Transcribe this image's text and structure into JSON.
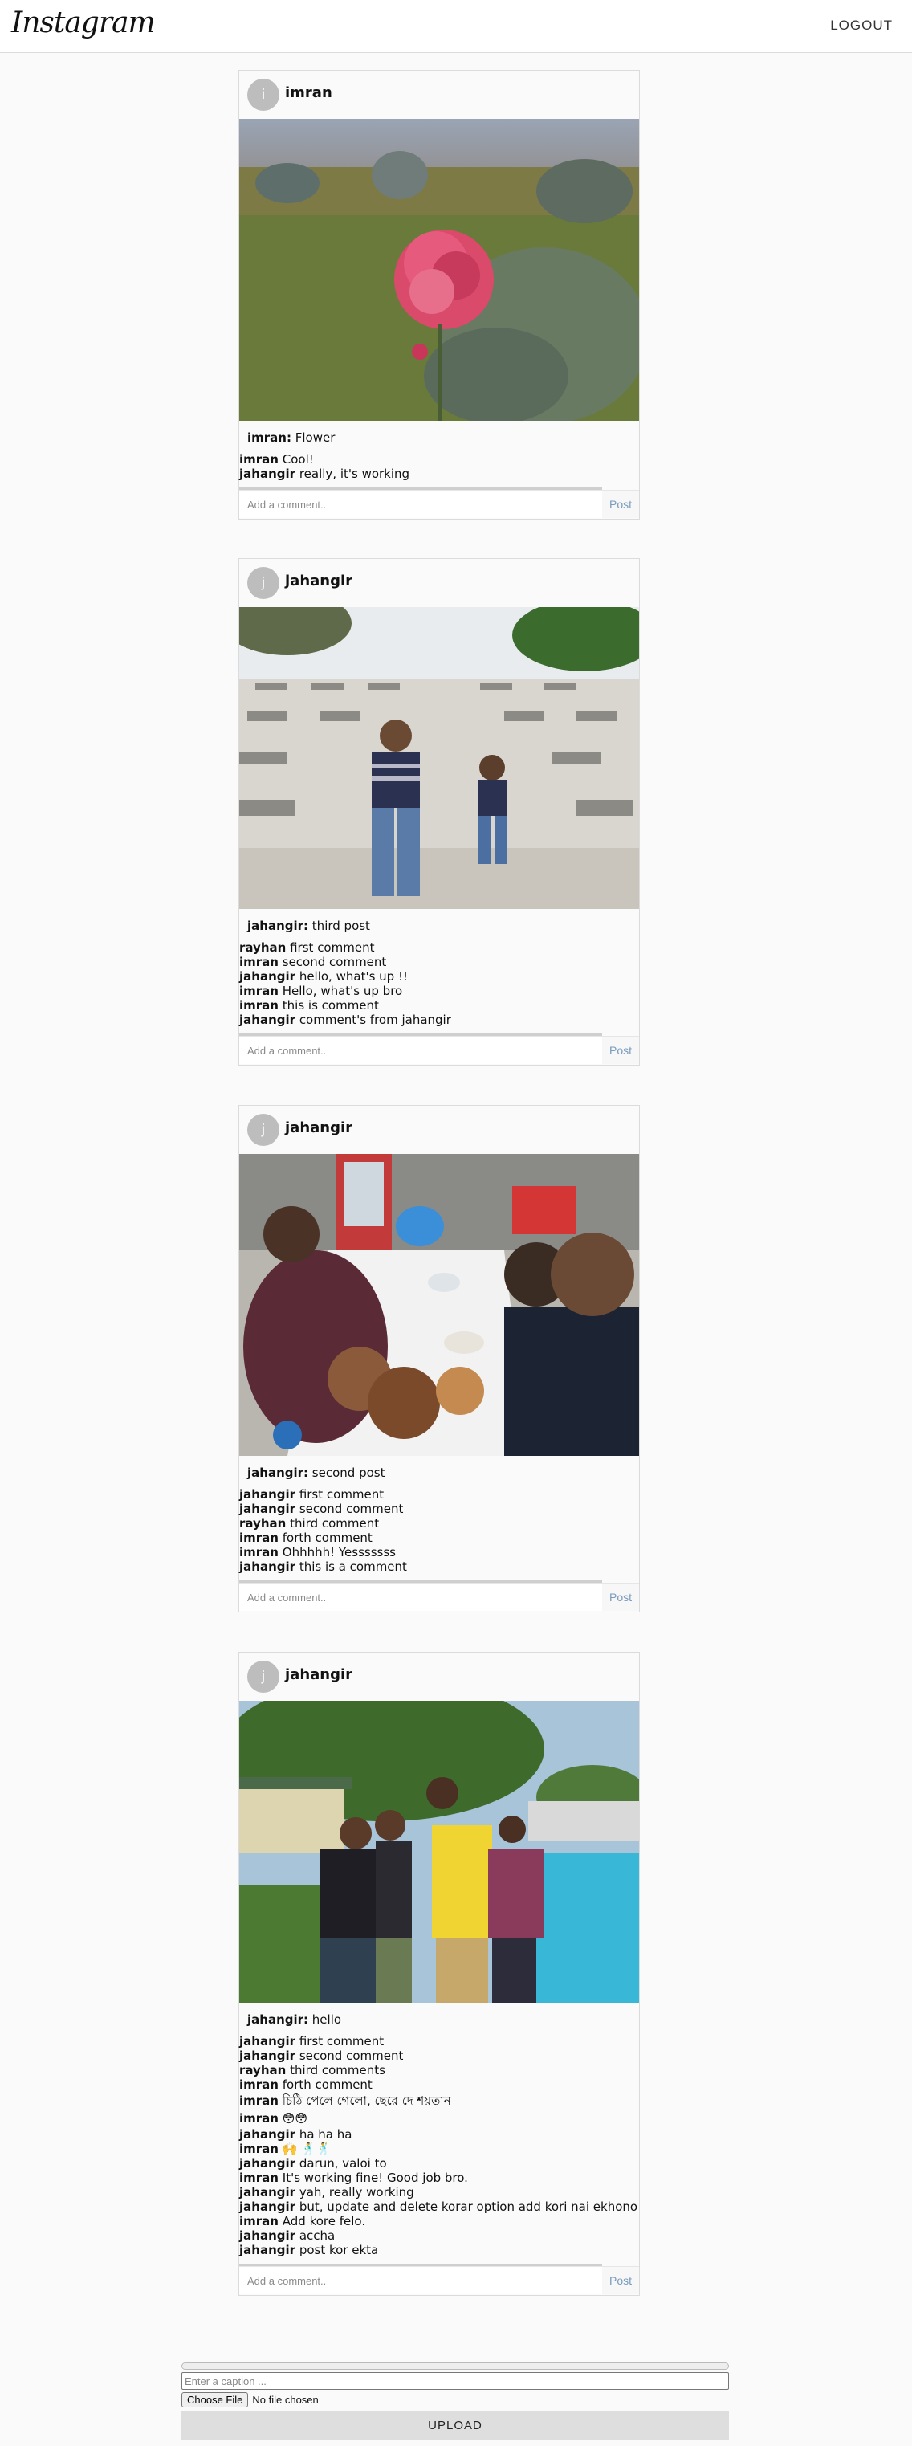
{
  "header": {
    "logo": "Instagram",
    "logout_label": "LOGOUT"
  },
  "posts": [
    {
      "username": "imran",
      "avatar_letter": "i",
      "image_desc": "rose-photo",
      "caption_user": "imran:",
      "caption_text": " Flower",
      "comments": [
        {
          "user": "imran",
          "text": "Cool!"
        },
        {
          "user": "jahangir",
          "text": "really, it's working"
        }
      ],
      "placeholder": "Add a comment..",
      "post_label": "Post"
    },
    {
      "username": "jahangir",
      "avatar_letter": "j",
      "image_desc": "two-people-photo",
      "caption_user": "jahangir:",
      "caption_text": " third post",
      "comments": [
        {
          "user": "rayhan",
          "text": "first comment"
        },
        {
          "user": "imran",
          "text": "second comment"
        },
        {
          "user": "jahangir",
          "text": "hello, what's up !!"
        },
        {
          "user": "imran",
          "text": "Hello, what's up bro"
        },
        {
          "user": "imran",
          "text": "this is comment"
        },
        {
          "user": "jahangir",
          "text": "comment's from jahangir"
        }
      ],
      "placeholder": "Add a comment..",
      "post_label": "Post"
    },
    {
      "username": "jahangir",
      "avatar_letter": "j",
      "image_desc": "restaurant-selfie-photo",
      "caption_user": "jahangir:",
      "caption_text": " second post",
      "comments": [
        {
          "user": "jahangir",
          "text": "first comment"
        },
        {
          "user": "jahangir",
          "text": "second comment"
        },
        {
          "user": "rayhan",
          "text": "third comment"
        },
        {
          "user": "imran",
          "text": "forth comment"
        },
        {
          "user": "imran",
          "text": "Ohhhhh! Yesssssss"
        },
        {
          "user": "jahangir",
          "text": "this is a comment"
        }
      ],
      "placeholder": "Add a comment..",
      "post_label": "Post"
    },
    {
      "username": "jahangir",
      "avatar_letter": "j",
      "image_desc": "group-photo",
      "caption_user": "jahangir:",
      "caption_text": " hello",
      "comments": [
        {
          "user": "jahangir",
          "text": "first comment"
        },
        {
          "user": "jahangir",
          "text": "second comment"
        },
        {
          "user": "rayhan",
          "text": "third comments"
        },
        {
          "user": "imran",
          "text": "forth comment"
        },
        {
          "user": "imran",
          "text": "চিঠি পেলে গেলো, ছেরে দে শয়তান"
        },
        {
          "user": "imran",
          "text": "😳😳"
        },
        {
          "user": "jahangir",
          "text": "ha ha ha"
        },
        {
          "user": "imran",
          "text": "🙌 🕺🕺"
        },
        {
          "user": "jahangir",
          "text": "darun, valoi to"
        },
        {
          "user": "imran",
          "text": "It's working fine! Good job bro."
        },
        {
          "user": "jahangir",
          "text": "yah, really working"
        },
        {
          "user": "jahangir",
          "text": "but, update and delete korar option add kori nai ekhono"
        },
        {
          "user": "imran",
          "text": "Add kore felo."
        },
        {
          "user": "jahangir",
          "text": "accha"
        },
        {
          "user": "jahangir",
          "text": "post kor ekta"
        }
      ],
      "placeholder": "Add a comment..",
      "post_label": "Post"
    }
  ],
  "upload": {
    "caption_placeholder": "Enter a caption ...",
    "choose_file_label": "Choose File",
    "no_file_label": "No file chosen",
    "upload_label": "UPLOAD",
    "progress": 0
  }
}
